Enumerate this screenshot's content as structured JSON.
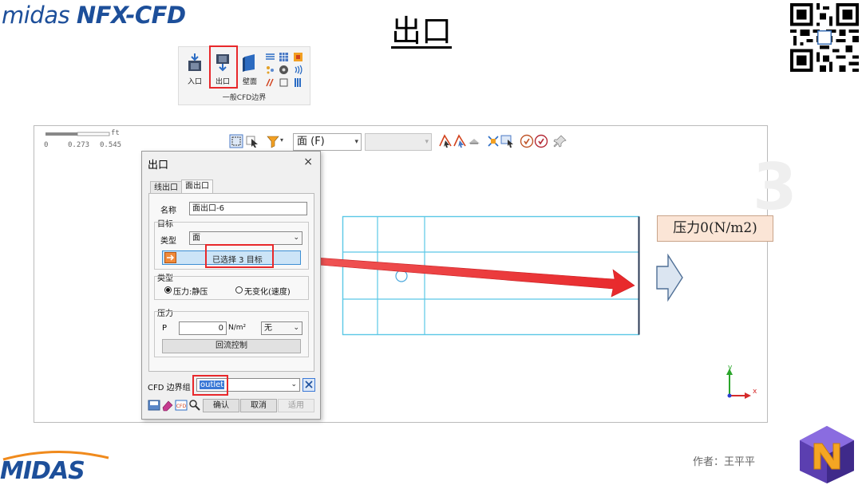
{
  "slide": {
    "brand_prefix": "midas",
    "brand_product": "NFX-CFD",
    "title": "出口",
    "author": "作者：王平平",
    "footer_logo": "MIDAS"
  },
  "ribbon": {
    "buttons": [
      {
        "label": "入口",
        "icon": "inlet-icon"
      },
      {
        "label": "出口",
        "icon": "outlet-icon"
      },
      {
        "label": "壁面",
        "icon": "wall-icon"
      }
    ],
    "group_caption": "一般CFD边界"
  },
  "app": {
    "ruler_labels": [
      "0",
      "0.273",
      "0.545"
    ],
    "ruler_unit": "ft",
    "toolbar": {
      "view_combo": "面 (F)",
      "second_combo": ""
    },
    "axis": {
      "y": "y",
      "x": "x"
    }
  },
  "dialog": {
    "title": "出口",
    "close": "×",
    "tabs": [
      "线出口",
      "面出口"
    ],
    "active_tab": "面出口",
    "name_label": "名称",
    "name_value": "面出口-6",
    "target_group": "目标",
    "type_label": "类型",
    "type_value": "面",
    "selection_text": "已选择 3 目标",
    "bc_type_group": "类型",
    "radio_static": "压力:静压",
    "radio_nochange": "无变化(速度)",
    "pressure_group": "压力",
    "p_label": "P",
    "p_value": "0",
    "p_unit": "N/m²",
    "p_func": "无",
    "backflow_button": "回流控制",
    "bc_group_label": "CFD 边界组",
    "bc_group_value": "outlet",
    "ok": "确认",
    "cancel": "取消",
    "apply": "适用"
  },
  "callout": {
    "text": "压力0(N/m2)"
  },
  "colors": {
    "accent_red": "#e8282b",
    "mesh_cyan": "#5bc8e6",
    "brand_blue": "#1d4f9a",
    "callout_fill": "#fbe5d6"
  }
}
